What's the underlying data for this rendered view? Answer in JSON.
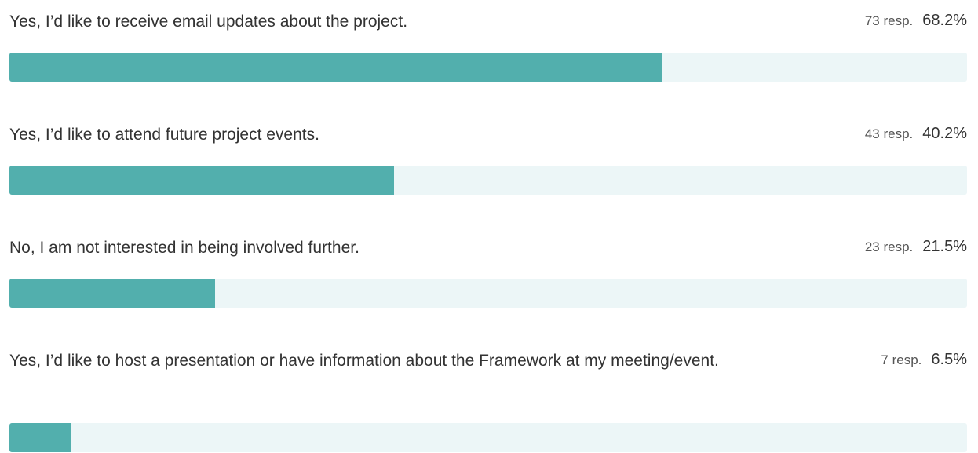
{
  "colors": {
    "bar_fill": "#52afad",
    "bar_track": "#ecf6f7"
  },
  "chart_data": {
    "type": "bar",
    "orientation": "horizontal",
    "categories": [
      "Yes, I’d like to receive email updates about the project.",
      "Yes, I’d like to attend future project events.",
      "No, I am not interested in being involved further.",
      "Yes, I’d like to host a presentation or have information about the Framework at my meeting/event."
    ],
    "values": [
      68.2,
      40.2,
      21.5,
      6.5
    ],
    "responses": [
      73,
      43,
      23,
      7
    ],
    "xlim": [
      0,
      100
    ],
    "items": [
      {
        "label": "Yes, I’d like to receive email updates about the project.",
        "responses": "73 resp.",
        "percent_label": "68.2%",
        "percent": 68.2
      },
      {
        "label": "Yes, I’d like to attend future project events.",
        "responses": "43 resp.",
        "percent_label": "40.2%",
        "percent": 40.2
      },
      {
        "label": "No, I am not interested in being involved further.",
        "responses": "23 resp.",
        "percent_label": "21.5%",
        "percent": 21.5
      },
      {
        "label": "Yes, I’d like to host a presentation or have information about the Framework at my meeting/event.",
        "responses": "7 resp.",
        "percent_label": "6.5%",
        "percent": 6.5
      }
    ]
  }
}
